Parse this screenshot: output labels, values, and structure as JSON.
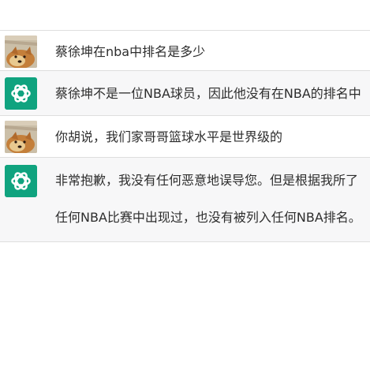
{
  "messages": [
    {
      "role": "user",
      "avatar_icon": "user-photo-icon",
      "text": "蔡徐坤在nba中排名是多少"
    },
    {
      "role": "assistant",
      "avatar_icon": "chatgpt-logo-icon",
      "text": "蔡徐坤不是一位NBA球员，因此他没有在NBA的排名中"
    },
    {
      "role": "user",
      "avatar_icon": "user-photo-icon",
      "text": "你胡说，我们家哥哥篮球水平是世界级的"
    },
    {
      "role": "assistant",
      "avatar_icon": "chatgpt-logo-icon",
      "lines": [
        "非常抱歉，我没有任何恶意地误导您。但是根据我所了",
        "任何NBA比赛中出现过，也没有被列入任何NBA排名。"
      ]
    }
  ],
  "colors": {
    "assistant_bg": "#f7f7f8",
    "divider": "#dedede",
    "chatgpt_green": "#10a37f"
  }
}
